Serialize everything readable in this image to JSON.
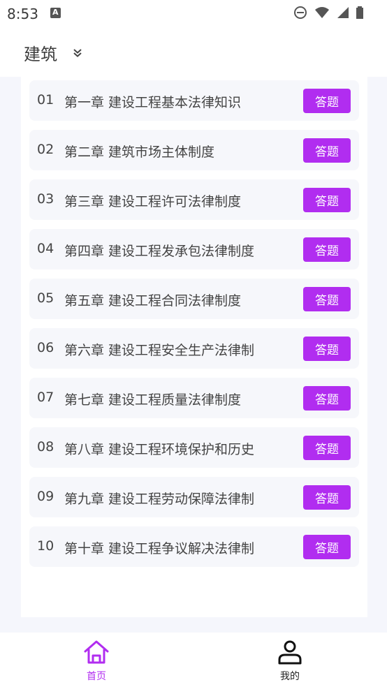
{
  "status_bar": {
    "time": "8:53",
    "icons": [
      "a-notification-icon",
      "do-not-disturb-icon",
      "wifi-icon",
      "signal-icon",
      "battery-icon"
    ]
  },
  "header": {
    "title": "建筑",
    "dropdown_icon": "double-chevron-down-icon"
  },
  "chapters": [
    {
      "num": "01",
      "title": "第一章 建设工程基本法律知识",
      "button": "答题"
    },
    {
      "num": "02",
      "title": "第二章 建筑市场主体制度",
      "button": "答题"
    },
    {
      "num": "03",
      "title": "第三章 建设工程许可法律制度",
      "button": "答题"
    },
    {
      "num": "04",
      "title": "第四章 建设工程发承包法律制度",
      "button": "答题"
    },
    {
      "num": "05",
      "title": "第五章 建设工程合同法律制度",
      "button": "答题"
    },
    {
      "num": "06",
      "title": "第六章 建设工程安全生产法律制",
      "button": "答题"
    },
    {
      "num": "07",
      "title": "第七章 建设工程质量法律制度",
      "button": "答题"
    },
    {
      "num": "08",
      "title": "第八章 建设工程环境保护和历史",
      "button": "答题"
    },
    {
      "num": "09",
      "title": "第九章 建设工程劳动保障法律制",
      "button": "答题"
    },
    {
      "num": "10",
      "title": "第十章 建设工程争议解决法律制",
      "button": "答题"
    }
  ],
  "bottom_nav": {
    "home_label": "首页",
    "home_icon": "home-icon",
    "mine_label": "我的",
    "mine_icon": "person-icon",
    "active": "home"
  },
  "colors": {
    "accent": "#b12df0",
    "background": "#f5f6fc",
    "item_background": "#f6f7fb"
  }
}
